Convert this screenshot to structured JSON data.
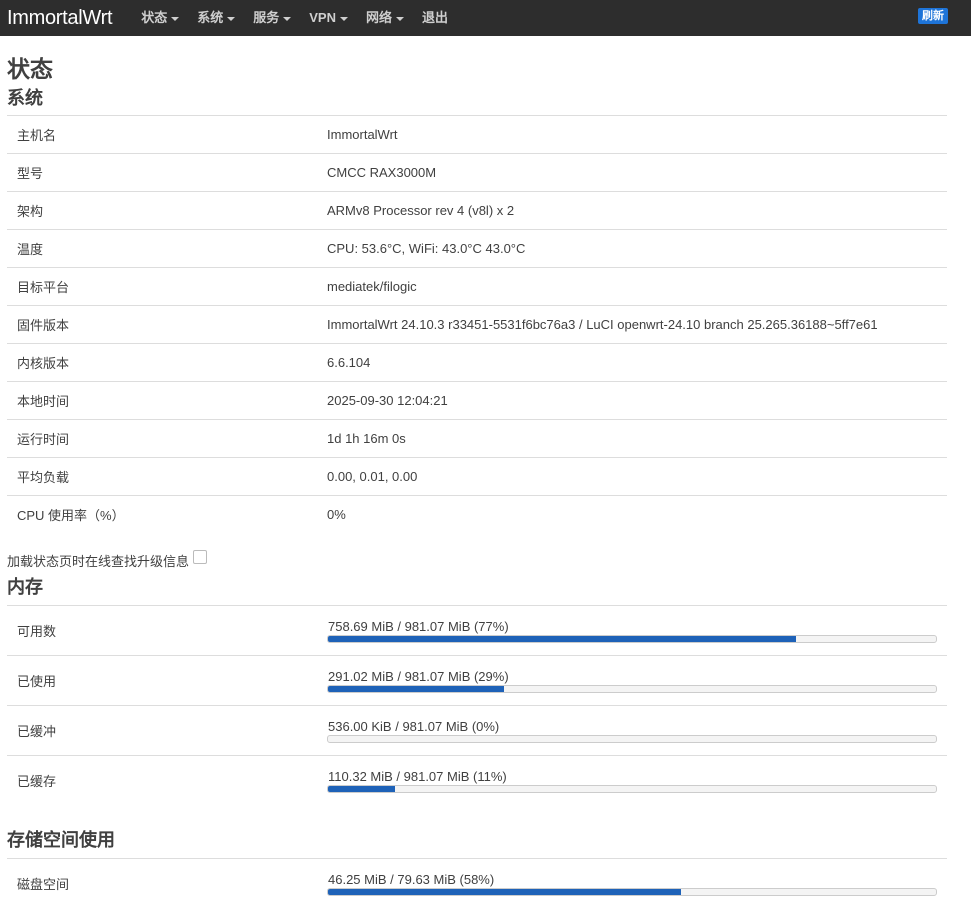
{
  "navbar": {
    "brand": "ImmortalWrt",
    "menu": [
      {
        "label": "状态",
        "dropdown": true
      },
      {
        "label": "系统",
        "dropdown": true
      },
      {
        "label": "服务",
        "dropdown": true
      },
      {
        "label": "VPN",
        "dropdown": true
      },
      {
        "label": "网络",
        "dropdown": true
      },
      {
        "label": "退出",
        "dropdown": false
      }
    ],
    "refresh_label": "刷新",
    "refresh_color": "#1e74d8"
  },
  "page_title": "状态",
  "system": {
    "title": "系统",
    "rows": [
      {
        "key": "主机名",
        "value": "ImmortalWrt"
      },
      {
        "key": "型号",
        "value": "CMCC RAX3000M"
      },
      {
        "key": "架构",
        "value": "ARMv8 Processor rev 4 (v8l) x 2"
      },
      {
        "key": "温度",
        "value": "CPU: 53.6°C, WiFi: 43.0°C 43.0°C"
      },
      {
        "key": "目标平台",
        "value": "mediatek/filogic"
      },
      {
        "key": "固件版本",
        "value": "ImmortalWrt 24.10.3 r33451-5531f6bc76a3 / LuCI openwrt-24.10 branch 25.265.36188~5ff7e61"
      },
      {
        "key": "内核版本",
        "value": "6.6.104"
      },
      {
        "key": "本地时间",
        "value": "2025-09-30 12:04:21"
      },
      {
        "key": "运行时间",
        "value": "1d 1h 16m 0s"
      },
      {
        "key": "平均负载",
        "value": "0.00, 0.01, 0.00"
      },
      {
        "key": "CPU 使用率（%）",
        "value": "0%"
      }
    ]
  },
  "update_check": {
    "label": "加载状态页时在线查找升级信息",
    "checked": false
  },
  "memory": {
    "title": "内存",
    "rows": [
      {
        "key": "可用数",
        "text": "758.69 MiB / 981.07 MiB (77%)",
        "percent": 77
      },
      {
        "key": "已使用",
        "text": "291.02 MiB / 981.07 MiB (29%)",
        "percent": 29
      },
      {
        "key": "已缓冲",
        "text": "536.00 KiB / 981.07 MiB (0%)",
        "percent": 0
      },
      {
        "key": "已缓存",
        "text": "110.32 MiB / 981.07 MiB (11%)",
        "percent": 11
      }
    ]
  },
  "storage": {
    "title": "存储空间使用",
    "rows": [
      {
        "key": "磁盘空间",
        "text": "46.25 MiB / 79.63 MiB (58%)",
        "percent": 58
      }
    ]
  },
  "colors": {
    "navbar_bg": "#2d2d2d",
    "bar_fill": "#1e62b8"
  }
}
